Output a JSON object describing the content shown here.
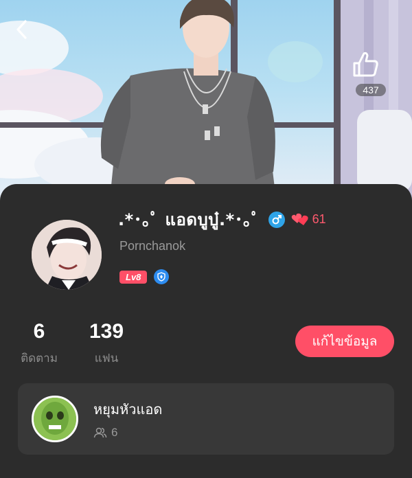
{
  "header": {
    "likes": "437"
  },
  "profile": {
    "display_name": ".*･｡ﾟ แอดบูบู๋.*･｡ﾟ",
    "username": "Pornchanok",
    "heart_count": "61",
    "level": "Lv8"
  },
  "stats": {
    "following_value": "6",
    "following_label": "ติดตาม",
    "fans_value": "139",
    "fans_label": "แฟน"
  },
  "edit_button": "แก้ไขข้อมูล",
  "group": {
    "name": "หยุมหัวแอด",
    "members": "6"
  },
  "colors": {
    "accent": "#ff4f67",
    "card_bg": "#2c2c2c",
    "male_badge": "#2fa4e8"
  },
  "icons": [
    "back-icon",
    "thumbs-up-icon",
    "male-icon",
    "hearts-icon",
    "shield-icon",
    "members-icon"
  ]
}
